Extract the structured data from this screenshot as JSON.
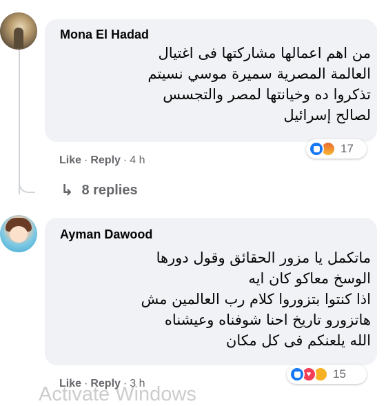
{
  "comments": [
    {
      "author": "Mona El Hadad",
      "text": "من اهم اعمالها مشاركتها فى اغتيال\nالعالمة المصرية سميرة موسي نسيتم\nتذكروا ده وخيانتها لمصر والتجسس\nلصالح إسرائيل",
      "reactions": {
        "icons": [
          "like-icon",
          "angry-icon"
        ],
        "count": "17"
      },
      "actions": {
        "like": "Like",
        "reply": "Reply",
        "time": "4 h"
      },
      "replies": "8 replies"
    },
    {
      "author": "Ayman Dawood",
      "text": "ماتكمل يا مزور الحقائق وقول دورها\nالوسخ معاكو كان ايه\nاذا كنتوا بتزوروا كلام رب العالمين مش\nهاتزورو تاريخ احنا شوفناه وعيشناه\nالله يلعنكم فى كل مكان",
      "reactions": {
        "icons": [
          "like-icon",
          "love-icon",
          "care-icon"
        ],
        "count": "15"
      },
      "actions": {
        "like": "Like",
        "reply": "Reply",
        "time": "3 h"
      }
    }
  ],
  "separator": "·",
  "watermark": "Activate Windows",
  "colors": {
    "like": "#1877f2",
    "love": "#f33e58",
    "bubble": "#f0f2f5",
    "meta": "#65676b"
  }
}
